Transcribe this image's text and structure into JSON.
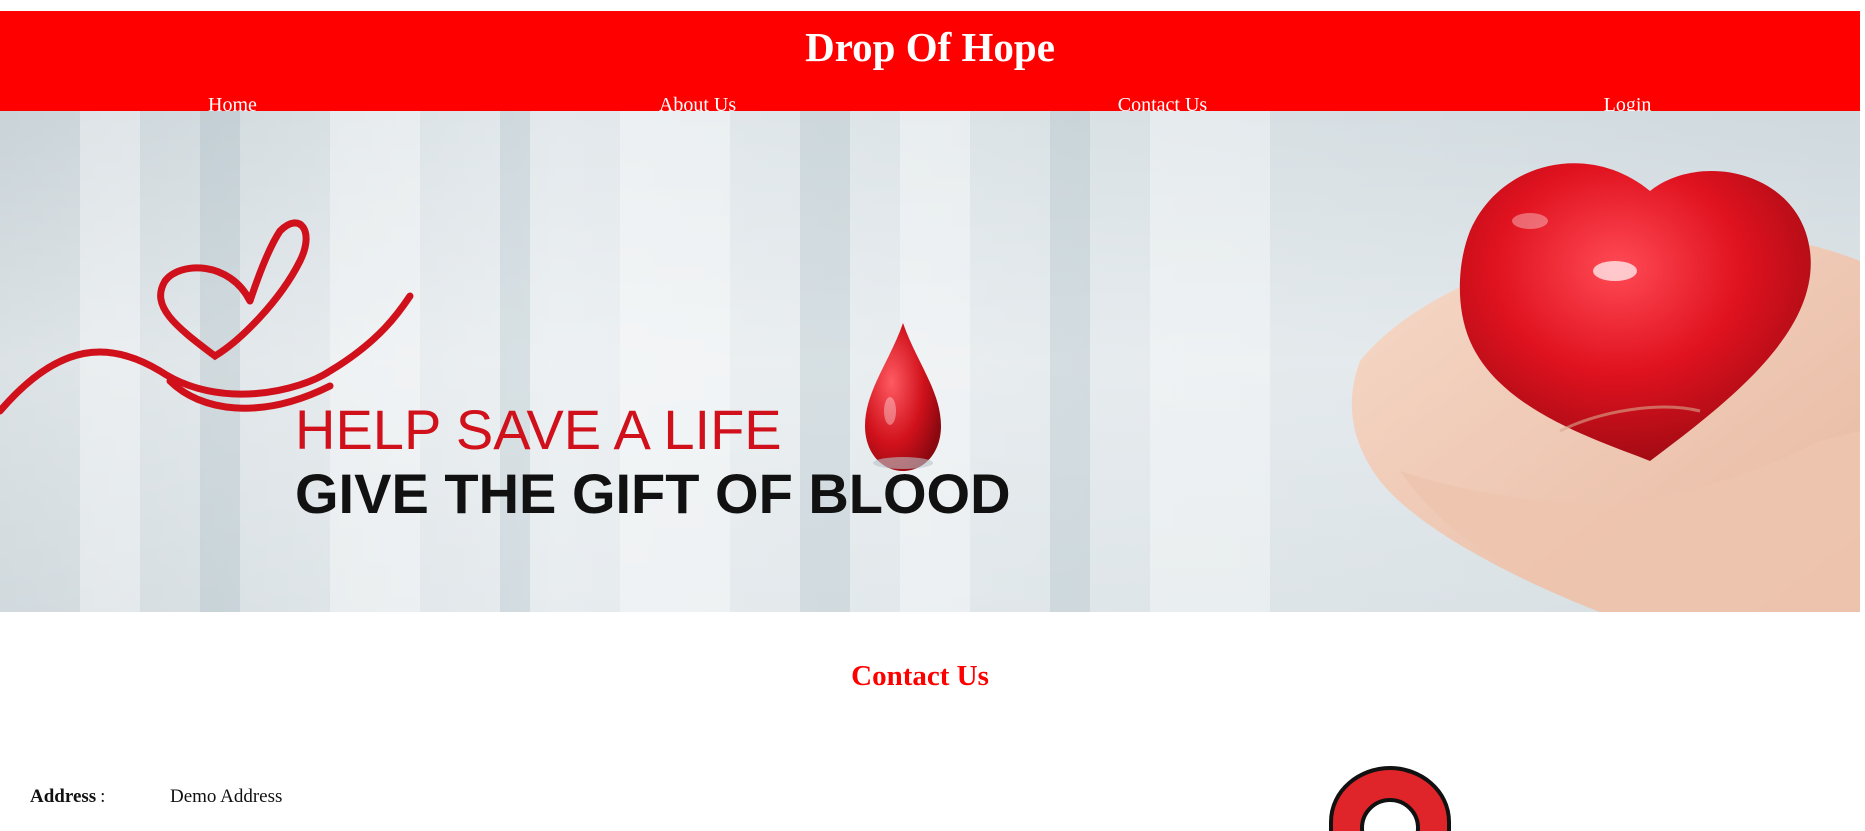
{
  "header": {
    "title": "Drop Of Hope",
    "background_color": "#ff0000"
  },
  "nav": {
    "items": [
      {
        "label": "Home"
      },
      {
        "label": "About Us"
      },
      {
        "label": "Contact Us"
      },
      {
        "label": "Login"
      }
    ]
  },
  "banner": {
    "line1": "HELP SAVE A LIFE",
    "line2": "GIVE THE GIFT OF BLOOD"
  },
  "contact": {
    "heading": "Contact Us",
    "address_label": "Address",
    "address_separator": ":",
    "address_value": "Demo Address"
  },
  "colors": {
    "accent": "#ff0000",
    "blood": "#d0111b"
  }
}
